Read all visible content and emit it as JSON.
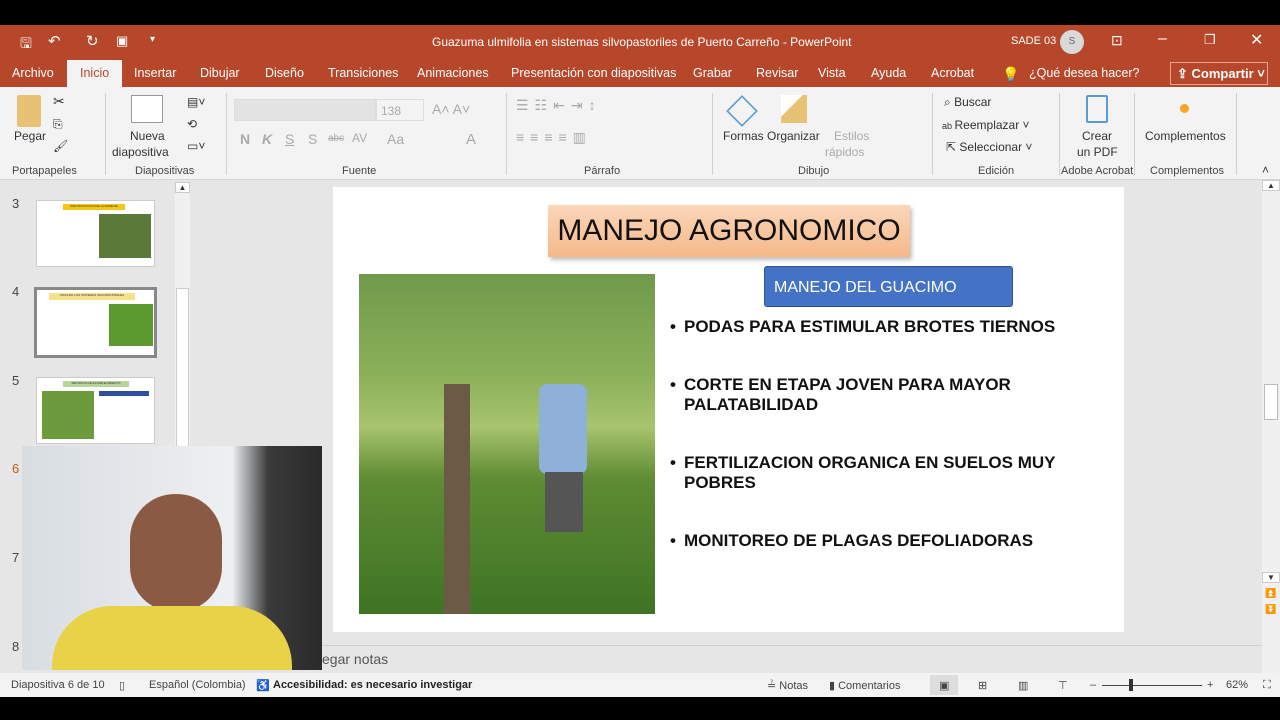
{
  "window": {
    "title": "Guazuma ulmifolia en sistemas silvopastoriles de Puerto Carreño  -  PowerPoint",
    "user": "SADE 03",
    "avatar_initial": "S"
  },
  "tabs": [
    "Archivo",
    "Inicio",
    "Insertar",
    "Dibujar",
    "Diseño",
    "Transiciones",
    "Animaciones",
    "Presentación con diapositivas",
    "Grabar",
    "Revisar",
    "Vista",
    "Ayuda",
    "Acrobat"
  ],
  "search_placeholder": "¿Qué desea hacer?",
  "share_label": "Compartir",
  "ribbon": {
    "paste": "Pegar",
    "new_slide_1": "Nueva",
    "new_slide_2": "diapositiva",
    "font_size": "138",
    "font_buttons": [
      "N",
      "K",
      "S",
      "S",
      "abc",
      "AV",
      "Aa",
      "A"
    ],
    "shapes": "Formas",
    "arrange": "Organizar",
    "quick_styles_1": "Estilos",
    "quick_styles_2": "rápidos",
    "find": "Buscar",
    "replace": "Reemplazar",
    "select": "Seleccionar",
    "pdf_1": "Crear",
    "pdf_2": "un PDF",
    "addins": "Complementos",
    "groups": [
      "Portapapeles",
      "Diapositivas",
      "Fuente",
      "Párrafo",
      "Dibujo",
      "Edición",
      "Adobe Acrobat",
      "Complementos"
    ]
  },
  "thumbnails": [
    {
      "num": "3",
      "title": "IDENTIFICACION DE LA ESPECIE"
    },
    {
      "num": "4",
      "title": "USOS EN LOS SISTEMAS SILVOPASTORILES"
    },
    {
      "num": "5",
      "title": "METODOS DE ESTABLECIMIENTO"
    },
    {
      "num": "6"
    },
    {
      "num": "7"
    },
    {
      "num": "8"
    }
  ],
  "slide": {
    "title": "MANEJO AGRONOMICO",
    "subtitle": "MANEJO DEL GUACIMO",
    "bullets": [
      "PODAS PARA ESTIMULAR BROTES TIERNOS",
      "CORTE EN ETAPA JOVEN PARA MAYOR PALATABILIDAD",
      "FERTILIZACION ORGANICA EN SUELOS MUY POBRES",
      "MONITOREO DE PLAGAS DEFOLIADORAS"
    ]
  },
  "notes_placeholder": "egar notas",
  "status": {
    "slide": "Diapositiva 6 de 10",
    "language": "Español (Colombia)",
    "accessibility": "Accesibilidad: es necesario investigar",
    "notes": "Notas",
    "comments": "Comentarios",
    "zoom": "62%",
    "zoom_percent": 62
  },
  "colors": {
    "accent": "#b7472a",
    "subtitle_bg": "#4472c4"
  }
}
